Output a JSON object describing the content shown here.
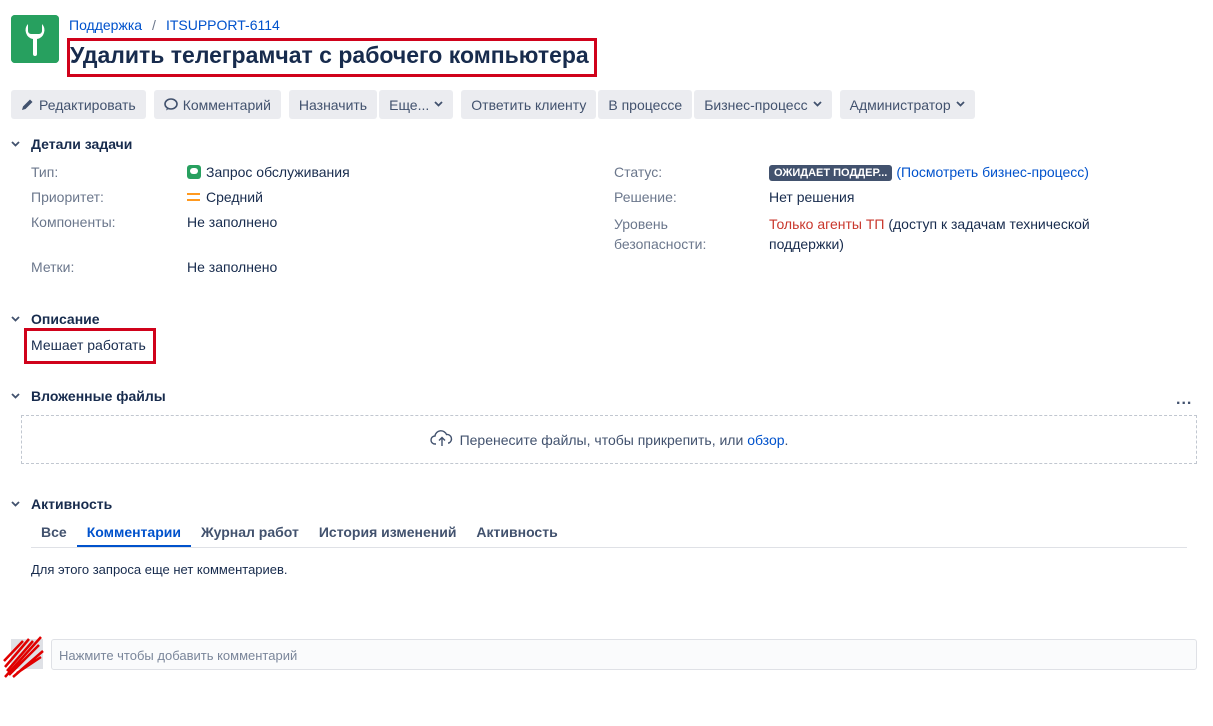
{
  "breadcrumb": {
    "project": "Поддержка",
    "sep": "/",
    "issue_key": "ITSUPPORT-6114"
  },
  "issue": {
    "title": "Удалить телеграмчат с рабочего компьютера"
  },
  "toolbar": {
    "edit": "Редактировать",
    "comment": "Комментарий",
    "assign": "Назначить",
    "more": "Еще...",
    "reply": "Ответить клиенту",
    "in_progress": "В процессе",
    "workflow": "Бизнес-процесс",
    "admin": "Администратор"
  },
  "details": {
    "heading": "Детали задачи",
    "type_label": "Тип:",
    "type_value": "Запрос обслуживания",
    "priority_label": "Приоритет:",
    "priority_value": "Средний",
    "components_label": "Компоненты:",
    "components_value": "Не заполнено",
    "labels_label": "Метки:",
    "labels_value": "Не заполнено",
    "status_label": "Статус:",
    "status_value": "ОЖИДАЕТ ПОДДЕР...",
    "status_link": "(Посмотреть бизнес-процесс)",
    "resolution_label": "Решение:",
    "resolution_value": "Нет решения",
    "security_label_1": "Уровень",
    "security_label_2": "безопасности:",
    "security_value_red": "Только агенты ТП",
    "security_value_rest_1": " (доступ к задачам технической",
    "security_value_rest_2": "поддержки)"
  },
  "description": {
    "heading": "Описание",
    "text": "Мешает работать"
  },
  "attachments": {
    "heading": "Вложенные файлы",
    "more": "...",
    "drop_text": "Перенесите файлы, чтобы прикрепить, или ",
    "browse": "обзор",
    "drop_end": "."
  },
  "activity": {
    "heading": "Активность",
    "tabs": [
      "Все",
      "Комментарии",
      "Журнал работ",
      "История изменений",
      "Активность"
    ],
    "active_tab": 1,
    "empty": "Для этого запроса еще нет комментариев."
  },
  "comment_box": {
    "placeholder": "Нажмите чтобы добавить комментарий"
  },
  "colors": {
    "accent": "#0052cc",
    "brand": "#27a05f",
    "highlight": "#d0021b",
    "status_badge": "#42526e"
  },
  "icons": {
    "logo": "wrench-logo-icon",
    "edit": "pencil-icon",
    "comment": "speech-bubble-icon",
    "dropdown": "chevron-down-icon",
    "section_toggle": "chevron-down-icon",
    "upload": "cloud-upload-icon",
    "type": "service-request-icon",
    "priority": "priority-medium-icon"
  }
}
